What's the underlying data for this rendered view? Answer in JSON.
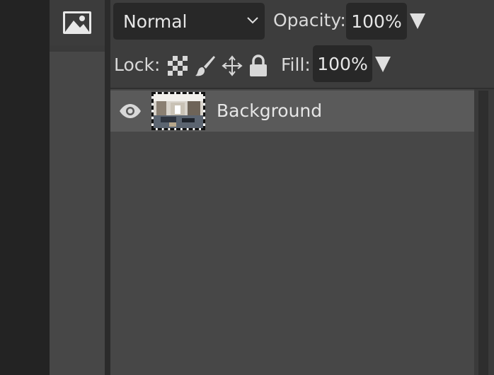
{
  "toolbar": {
    "image_tool_icon": "image-icon"
  },
  "layers_panel": {
    "blend_mode": "Normal",
    "opacity_label": "Opacity:",
    "opacity_value": "100%",
    "lock_label": "Lock:",
    "lock_icons": [
      "checkerboard-transparency-icon",
      "brush-icon",
      "move-arrows-icon",
      "padlock-icon"
    ],
    "fill_label": "Fill:",
    "fill_value": "100%",
    "layers": [
      {
        "name": "Background",
        "visible": true
      }
    ]
  },
  "colors": {
    "panel_bg": "#3d3d3d",
    "list_bg": "#474747",
    "selected_row": "#5a5a5a",
    "input_bg": "#282828",
    "text": "#e6e6e6"
  }
}
